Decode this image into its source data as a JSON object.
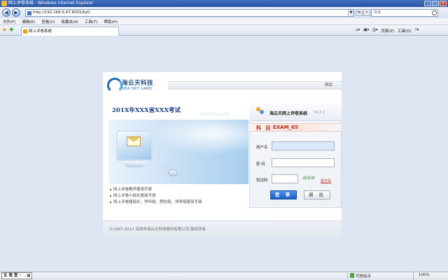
{
  "window": {
    "title": "网上评卷系统 - Windows Internet Explorer",
    "url": "http://192.168.6.47:8001/byt/",
    "search_placeholder": "百度"
  },
  "menu": [
    "文件(F)",
    "编辑(E)",
    "查看(V)",
    "收藏夹(A)",
    "工具(T)",
    "帮助(H)"
  ],
  "tab": {
    "label": "网上评卷系统"
  },
  "commands": {
    "page": "页面(P)",
    "tools": "工具(O)"
  },
  "logo": {
    "cn": "海云天科技",
    "en": "SEA SKY LAND"
  },
  "header": {
    "help": "帮助"
  },
  "exam_title": "201X年XXX省XXX考试",
  "watermark": "SeaSkyLand",
  "links": [
    "网上评卷教师使用手册",
    "网上评卷小组长使用手册",
    "网上评卷题组长、学科组、质检组、领导组使用手册"
  ],
  "login": {
    "title": "海云天网上评卷系统",
    "version": "V6.5.3",
    "subject_label": "科 目",
    "subject_value": "EXAM_65",
    "username_label": "用户名",
    "password_label": "密  码",
    "captcha_label": "验证码",
    "captcha_text": "成动说",
    "captcha_refresh": "看不清",
    "login_button": "登 录",
    "exit_button": "退 出"
  },
  "footer": {
    "copyright": "©1997-2012 深圳市海云天科技股份有限公司 版权所有"
  },
  "status": {
    "ime": [
      "五",
      "笔",
      "型"
    ],
    "zone": "可信站点",
    "zoom": "100%"
  },
  "colors": {
    "accent": "#1c5fc8",
    "subject_red": "#c0281b",
    "title_blue": "#1a3f8a"
  }
}
